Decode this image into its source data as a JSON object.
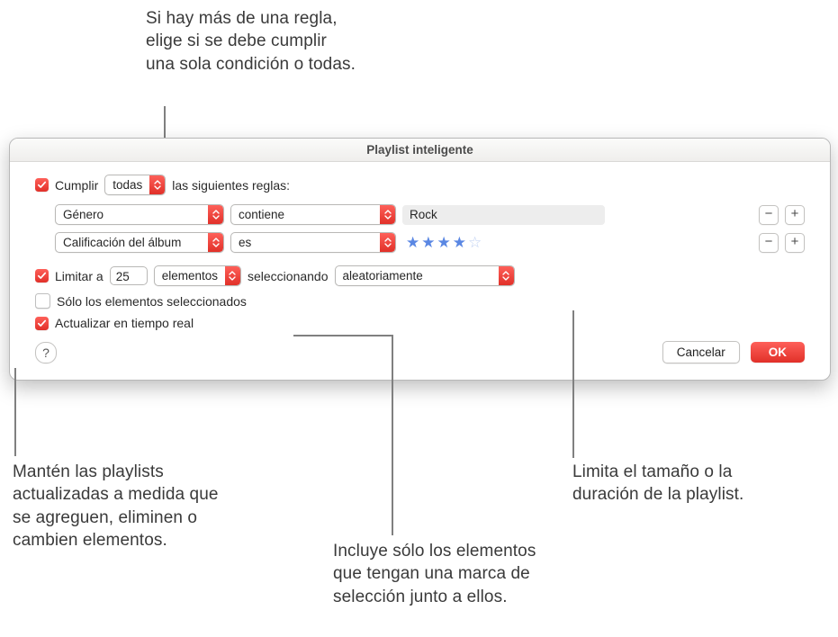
{
  "callouts": {
    "top": "Si hay más de una regla,\nelige si se debe cumplir\nuna sola condición o todas.",
    "bottom_left": "Mantén las playlists\nactualizadas a medida que\nse agreguen, eliminen o\ncambien elementos.",
    "bottom_mid": "Incluye sólo los elementos\nque tengan una marca de\nselección junto a ellos.",
    "bottom_right": "Limita el tamaño o la\nduración de la playlist."
  },
  "dialog": {
    "title": "Playlist inteligente"
  },
  "match": {
    "checkbox_checked": true,
    "label_prefix": "Cumplir",
    "mode": "todas",
    "label_suffix": "las siguientes reglas:"
  },
  "rules": [
    {
      "field": "Género",
      "operator": "contiene",
      "value_type": "text",
      "value": "Rock",
      "field_width": 182,
      "op_width": 182
    },
    {
      "field": "Calificación del álbum",
      "operator": "es",
      "value_type": "stars",
      "stars_filled": 4,
      "stars_total": 5,
      "field_width": 182,
      "op_width": 182
    }
  ],
  "limit": {
    "checked": true,
    "label": "Limitar a",
    "count": "25",
    "unit": "elementos",
    "selecting_label": "seleccionando",
    "method": "aleatoriamente"
  },
  "only_checked": {
    "checked": false,
    "label": "Sólo los elementos seleccionados"
  },
  "live_update": {
    "checked": true,
    "label": "Actualizar en tiempo real"
  },
  "buttons": {
    "help": "?",
    "cancel": "Cancelar",
    "ok": "OK"
  },
  "icons": {
    "minus": "−",
    "plus": "+"
  }
}
